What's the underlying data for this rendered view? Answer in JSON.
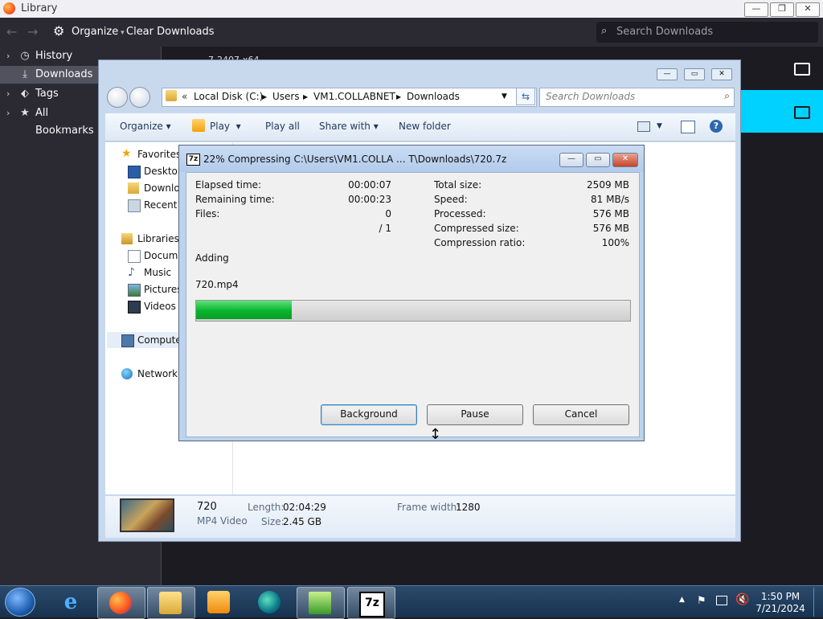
{
  "library": {
    "title": "Library",
    "toolbar": {
      "organize": "Organize",
      "clear": "Clear Downloads",
      "search_placeholder": "Search Downloads"
    },
    "sidebar": [
      {
        "label": "History",
        "icon": "clock-icon"
      },
      {
        "label": "Downloads",
        "icon": "download-icon"
      },
      {
        "label": "Tags",
        "icon": "tag-icon"
      },
      {
        "label": "All Bookmarks",
        "icon": "star-icon"
      }
    ],
    "item_partial": "7-2407-x64"
  },
  "explorer": {
    "path": [
      "Local Disk (C:)",
      "Users",
      "VM1.COLLABNET",
      "Downloads"
    ],
    "search_placeholder": "Search Downloads",
    "commands": [
      "Organize",
      "Play",
      "Play all",
      "Share with",
      "New folder"
    ],
    "nav": {
      "favorites": "Favorites",
      "favorite_items": [
        "Desktop",
        "Downloads",
        "Recent Places"
      ],
      "libraries": "Libraries",
      "library_items": [
        "Documents",
        "Music",
        "Pictures",
        "Videos"
      ],
      "computer": "Computer",
      "network": "Network"
    },
    "details": {
      "name": "720",
      "type": "MP4 Video",
      "length_label": "Length:",
      "length": "02:04:29",
      "size_label": "Size:",
      "size": "2.45 GB",
      "frame_label": "Frame width:",
      "frame": "1280"
    }
  },
  "zip": {
    "title": "22% Compressing C:\\Users\\VM1.COLLA ... T\\Downloads\\720.7z",
    "progress": 0.22,
    "stats_left": [
      {
        "label": "Elapsed time:",
        "value": "00:00:07"
      },
      {
        "label": "Remaining time:",
        "value": "00:00:23"
      },
      {
        "label": "Files:",
        "value": "0"
      },
      {
        "label": "",
        "value": "/ 1"
      }
    ],
    "stats_right": [
      {
        "label": "Total size:",
        "value": "2509 MB"
      },
      {
        "label": "Speed:",
        "value": "81 MB/s"
      },
      {
        "label": "Processed:",
        "value": "576 MB"
      },
      {
        "label": "Compressed size:",
        "value": "576 MB"
      },
      {
        "label": "Compression ratio:",
        "value": "100%"
      }
    ],
    "action": "Adding",
    "file": "720.mp4",
    "buttons": {
      "background": "Background",
      "pause": "Pause",
      "cancel": "Cancel"
    }
  },
  "taskbar": {
    "time": "1:50 PM",
    "date": "7/21/2024",
    "apps": [
      "ie-icon",
      "firefox-icon",
      "explorer-icon",
      "media-player-icon",
      "app-icon",
      "notepad-icon",
      "7zip-icon"
    ]
  },
  "colors": {
    "progress": "#08b52d",
    "accent_cyan": "#00d2ff"
  }
}
